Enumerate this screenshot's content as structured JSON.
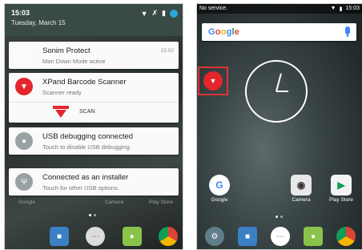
{
  "left_screen": {
    "status": {
      "time": "15:03",
      "date": "Tuesday, March 15"
    },
    "notifications": [
      {
        "app": "Sonim Protect",
        "text": "Man Down Mode active",
        "time": "15:02",
        "icon": "lock-icon",
        "icon_color": "#9aa1a3"
      },
      {
        "app": "XPand Barcode Scanner",
        "text": "Scanner ready",
        "icon": "wifi-shield-icon",
        "icon_color": "#e3262b",
        "action_label": "SCAN"
      },
      {
        "app": "USB debugging connected",
        "text": "Touch to disable USB debugging.",
        "icon": "android-debug-icon",
        "icon_color": "#9aa1a3"
      },
      {
        "app": "Connected as an installer",
        "text": "Touch for other USB options.",
        "icon": "usb-icon",
        "icon_color": "#9aa1a3"
      }
    ],
    "dim_labels": {
      "google": "Google",
      "camera": "Camera",
      "play_store": "Play Store"
    }
  },
  "right_screen": {
    "status": {
      "carrier": "No service.",
      "time": "15:03"
    },
    "search": {
      "logo": "Google"
    },
    "apps": {
      "google": "Google",
      "camera": "Camera",
      "play_store": "Play Store"
    }
  }
}
